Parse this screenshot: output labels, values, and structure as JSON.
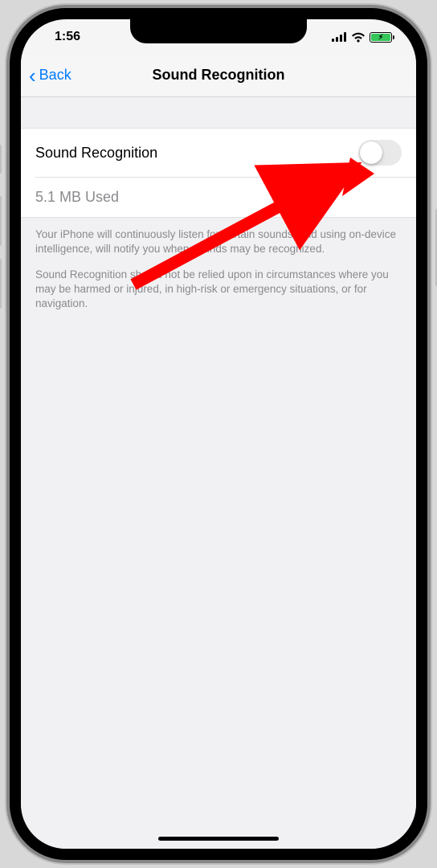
{
  "status": {
    "time": "1:56"
  },
  "nav": {
    "back_label": "Back",
    "title": "Sound Recognition"
  },
  "main": {
    "toggle_label": "Sound Recognition",
    "storage_label": "5.1 MB Used",
    "toggle_on": false
  },
  "footer": {
    "para1": "Your iPhone will continuously listen for certain sounds, and using on-device intelligence, will notify you when sounds may be recognized.",
    "para2": "Sound Recognition should not be relied upon in circumstances where you may be harmed or injured, in high-risk or emergency situations, or for navigation."
  }
}
